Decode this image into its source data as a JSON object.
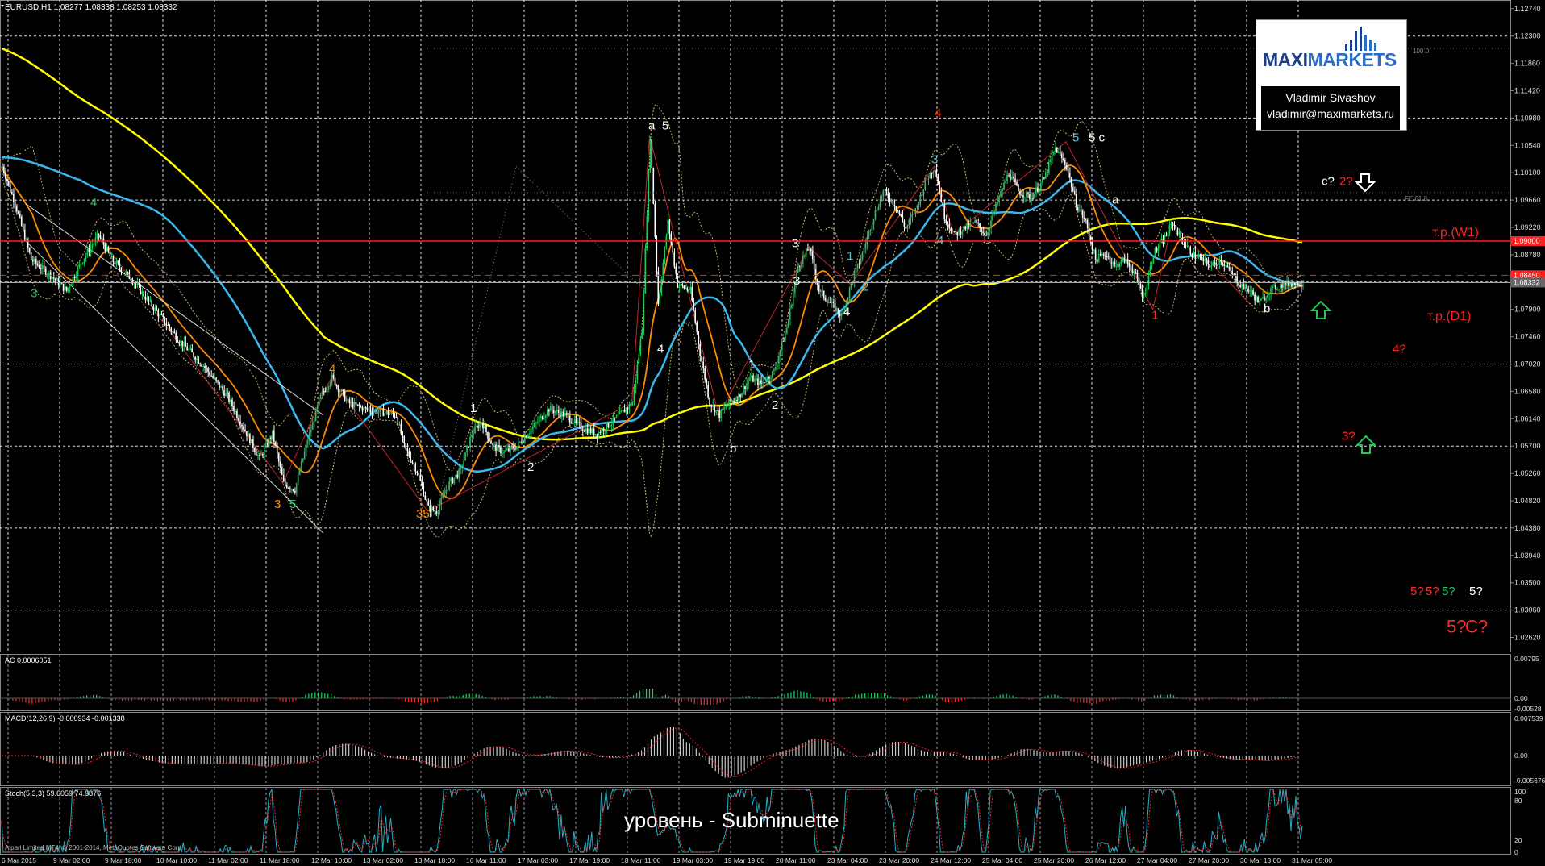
{
  "header": {
    "symbol_info": "EURUSD,H1  1.08277 1.08338 1.08253 1.08332"
  },
  "logo": {
    "brand_left": "MAXI",
    "brand_right": "MARKETS",
    "author": "Vladimir Sivashov",
    "email": "vladimir@maximarkets.ru"
  },
  "footer": {
    "caption": "уровень - Subminuette",
    "copyright": "Alpari Limited MT4, © 2001-2014, MetaQuotes Software Corp."
  },
  "levels": {
    "tp_w1": "т.р.(W1)",
    "tp_d1": "т.р.(D1)",
    "fib_100": "100.0",
    "fe_618": "FE 61.8",
    "line_w1_price": "1.09000",
    "line_d1_price": "1.08450",
    "current_price": "1.08332"
  },
  "indicators": {
    "ac_label": "AC 0.0006051",
    "macd_label": "MACD(12,26,9) -0.000934 -0.001338",
    "stoch_label": "Stoch(5,3,3) 59.6059 74.9876",
    "ac_ticks": [
      "0.00795",
      "0.00",
      "-0.00528"
    ],
    "macd_ticks": [
      "0.007539",
      "0.00",
      "-0.005676"
    ],
    "stoch_ticks": [
      "100",
      "80",
      "20",
      "0"
    ]
  },
  "chart_data": {
    "type": "candlestick",
    "symbol": "EURUSD",
    "timeframe": "H1",
    "ohlc_last": {
      "open": 1.08277,
      "high": 1.08338,
      "low": 1.08253,
      "close": 1.08332
    },
    "y_ticks": [
      "1.12740",
      "1.12300",
      "1.11860",
      "1.11420",
      "1.10980",
      "1.10540",
      "1.10100",
      "1.09660",
      "1.09220",
      "1.08780",
      "1.08340",
      "1.07900",
      "1.07460",
      "1.07020",
      "1.06580",
      "1.06140",
      "1.05700",
      "1.05260",
      "1.04820",
      "1.04380",
      "1.03940",
      "1.03500",
      "1.03060",
      "1.02620"
    ],
    "ylim": [
      1.0238,
      1.1288
    ],
    "x_ticks": [
      "6 Mar 2015",
      "9 Mar 02:00",
      "9 Mar 18:00",
      "10 Mar 10:00",
      "11 Mar 02:00",
      "11 Mar 18:00",
      "12 Mar 10:00",
      "13 Mar 02:00",
      "13 Mar 18:00",
      "16 Mar 11:00",
      "17 Mar 03:00",
      "17 Mar 19:00",
      "18 Mar 11:00",
      "19 Mar 03:00",
      "19 Mar 19:00",
      "20 Mar 11:00",
      "23 Mar 04:00",
      "23 Mar 20:00",
      "24 Mar 12:00",
      "25 Mar 04:00",
      "25 Mar 20:00",
      "26 Mar 12:00",
      "27 Mar 04:00",
      "27 Mar 20:00",
      "30 Mar 13:00",
      "31 Mar 05:00"
    ],
    "price_path": [
      [
        0,
        1.102
      ],
      [
        8,
        1.096
      ],
      [
        18,
        1.087
      ],
      [
        30,
        1.0845
      ],
      [
        40,
        1.082
      ],
      [
        50,
        1.087
      ],
      [
        60,
        1.091
      ],
      [
        68,
        1.087
      ],
      [
        80,
        1.084
      ],
      [
        95,
        1.079
      ],
      [
        110,
        1.074
      ],
      [
        125,
        1.07
      ],
      [
        140,
        1.065
      ],
      [
        150,
        1.06
      ],
      [
        160,
        1.055
      ],
      [
        168,
        1.059
      ],
      [
        175,
        1.051
      ],
      [
        182,
        1.05
      ],
      [
        190,
        1.058
      ],
      [
        198,
        1.065
      ],
      [
        205,
        1.068
      ],
      [
        215,
        1.064
      ],
      [
        225,
        1.063
      ],
      [
        235,
        1.0625
      ],
      [
        245,
        1.062
      ],
      [
        250,
        1.057
      ],
      [
        258,
        1.053
      ],
      [
        265,
        1.047
      ],
      [
        270,
        1.0465
      ],
      [
        278,
        1.051
      ],
      [
        285,
        1.053
      ],
      [
        292,
        1.059
      ],
      [
        298,
        1.061
      ],
      [
        305,
        1.057
      ],
      [
        312,
        1.056
      ],
      [
        320,
        1.057
      ],
      [
        330,
        1.06
      ],
      [
        340,
        1.063
      ],
      [
        350,
        1.062
      ],
      [
        360,
        1.06
      ],
      [
        370,
        1.059
      ],
      [
        380,
        1.061
      ],
      [
        392,
        1.064
      ],
      [
        398,
        1.076
      ],
      [
        403,
        1.107
      ],
      [
        408,
        1.08
      ],
      [
        414,
        1.093
      ],
      [
        420,
        1.083
      ],
      [
        428,
        1.082
      ],
      [
        434,
        1.072
      ],
      [
        440,
        1.064
      ],
      [
        446,
        1.062
      ],
      [
        452,
        1.064
      ],
      [
        458,
        1.065
      ],
      [
        465,
        1.068
      ],
      [
        472,
        1.067
      ],
      [
        480,
        1.069
      ],
      [
        488,
        1.076
      ],
      [
        495,
        1.086
      ],
      [
        502,
        1.089
      ],
      [
        508,
        1.082
      ],
      [
        515,
        1.08
      ],
      [
        522,
        1.078
      ],
      [
        528,
        1.083
      ],
      [
        535,
        1.088
      ],
      [
        542,
        1.094
      ],
      [
        548,
        1.098
      ],
      [
        555,
        1.096
      ],
      [
        562,
        1.092
      ],
      [
        568,
        1.095
      ],
      [
        575,
        1.1
      ],
      [
        580,
        1.102
      ],
      [
        586,
        1.094
      ],
      [
        592,
        1.091
      ],
      [
        598,
        1.092
      ],
      [
        605,
        1.093
      ],
      [
        612,
        1.091
      ],
      [
        620,
        1.097
      ],
      [
        626,
        1.101
      ],
      [
        632,
        1.098
      ],
      [
        640,
        1.097
      ],
      [
        648,
        1.1
      ],
      [
        655,
        1.105
      ],
      [
        662,
        1.102
      ],
      [
        668,
        1.096
      ],
      [
        674,
        1.093
      ],
      [
        680,
        1.087
      ],
      [
        686,
        1.088
      ],
      [
        692,
        1.086
      ],
      [
        698,
        1.087
      ],
      [
        704,
        1.085
      ],
      [
        710,
        1.081
      ],
      [
        716,
        1.088
      ],
      [
        722,
        1.09
      ],
      [
        728,
        1.093
      ],
      [
        734,
        1.09
      ],
      [
        740,
        1.088
      ],
      [
        746,
        1.087
      ],
      [
        752,
        1.086
      ],
      [
        758,
        1.087
      ],
      [
        764,
        1.085
      ],
      [
        770,
        1.083
      ],
      [
        776,
        1.082
      ],
      [
        782,
        1.08
      ],
      [
        788,
        1.082
      ],
      [
        796,
        1.083
      ],
      [
        806,
        1.0833
      ]
    ],
    "wave_labels": [
      {
        "text": "4",
        "value": 1.0956,
        "color": "#22c55e"
      },
      {
        "text": "3",
        "value": 1.081,
        "color": "#22c55e"
      },
      {
        "text": "4",
        "value": 1.0688,
        "color": "#ff8c00"
      },
      {
        "text": "3",
        "value": 1.047,
        "color": "#ff8c00"
      },
      {
        "text": "5",
        "value": 1.047,
        "color": "#22c55e"
      },
      {
        "text": "35",
        "value": 1.0455,
        "color": "#ff8c00"
      },
      {
        "text": "1",
        "value": 1.0625,
        "color": "#ffffff"
      },
      {
        "text": "2",
        "value": 1.053,
        "color": "#ffffff"
      },
      {
        "text": "3",
        "value": 1.083,
        "color": "#ffffff"
      },
      {
        "text": "a",
        "value": 1.108,
        "color": "#ffffff"
      },
      {
        "text": "5",
        "value": 1.108,
        "color": "#ffffff"
      },
      {
        "text": "4",
        "value": 1.072,
        "color": "#ffffff"
      },
      {
        "text": "b",
        "value": 1.056,
        "color": "#ffffff"
      },
      {
        "text": "1",
        "value": 1.0695,
        "color": "#ffffff"
      },
      {
        "text": "2",
        "value": 1.063,
        "color": "#ffffff"
      },
      {
        "text": "3",
        "value": 1.089,
        "color": "#ffffff"
      },
      {
        "text": "4",
        "value": 1.078,
        "color": "#ffffff"
      },
      {
        "text": "1",
        "value": 1.087,
        "color": "#5ec8d0"
      },
      {
        "text": "2",
        "value": 1.082,
        "color": "#5ec8d0"
      },
      {
        "text": "3",
        "value": 1.1025,
        "color": "#5ec8d0"
      },
      {
        "text": "4",
        "value": 1.0895,
        "color": "#5ec8d0"
      },
      {
        "text": "5",
        "value": 1.106,
        "color": "#5ec8d0"
      },
      {
        "text": "5 c",
        "value": 1.106,
        "color": "#ffffff"
      },
      {
        "text": "4",
        "value": 1.11,
        "color": "#ff4500"
      },
      {
        "text": "a",
        "value": 1.096,
        "color": "#ffffff"
      },
      {
        "text": "1",
        "value": 1.0775,
        "color": "#ff2a2a"
      },
      {
        "text": "b",
        "value": 1.0785,
        "color": "#ffffff"
      },
      {
        "text": "c?",
        "value": 1.099,
        "color": "#ffffff"
      },
      {
        "text": "2?",
        "value": 1.099,
        "color": "#ff2a2a"
      },
      {
        "text": "4?",
        "value": 1.072,
        "color": "#ff2a2a"
      },
      {
        "text": "3?",
        "value": 1.058,
        "color": "#ff2a2a"
      },
      {
        "text": "5?",
        "value": 1.033,
        "color": "#ff2a2a"
      },
      {
        "text": "5?",
        "value": 1.033,
        "color": "#ff2a2a"
      },
      {
        "text": "5?",
        "value": 1.033,
        "color": "#22c55e"
      },
      {
        "text": "5?",
        "value": 1.033,
        "color": "#ffffff"
      },
      {
        "text": "5?",
        "value": 1.027,
        "color": "#ff2a2a"
      },
      {
        "text": "C?",
        "value": 1.027,
        "color": "#ff2a2a"
      }
    ],
    "horizontal_lines": [
      {
        "name": "т.р.(W1)",
        "value": 1.09,
        "style": "solid",
        "color": "#ff2020"
      },
      {
        "name": "dashed",
        "value": 1.0845,
        "style": "dashed",
        "color": "#ff2020"
      },
      {
        "name": "current",
        "value": 1.08332,
        "style": "solid",
        "color": "#c0c0c0"
      }
    ],
    "colors": {
      "bull": "#22c55e",
      "bear": "#ffffff",
      "ma_yellow": "#ffff00",
      "ma_blue": "#3ab8f0",
      "ma_orange": "#ff8c00",
      "grid": "#ffffff",
      "level_red": "#ff2020"
    }
  }
}
